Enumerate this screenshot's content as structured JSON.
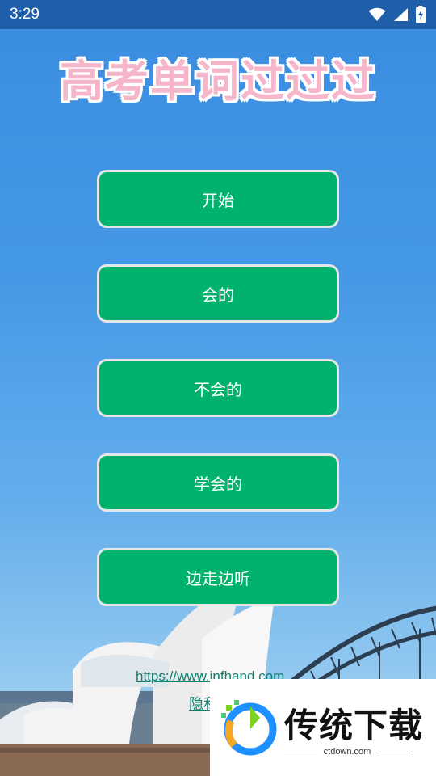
{
  "status_bar": {
    "time": "3:29",
    "icons": [
      "wifi-icon",
      "signal-icon",
      "battery-charging-icon"
    ]
  },
  "app": {
    "title": "高考单词过过过"
  },
  "menu": {
    "buttons": [
      {
        "label": "开始"
      },
      {
        "label": "会的"
      },
      {
        "label": "不会的"
      },
      {
        "label": "学会的"
      },
      {
        "label": "边走边听"
      }
    ]
  },
  "footer": {
    "url_text": "https://www.infhand.com",
    "privacy_text": "隐私"
  },
  "watermark": {
    "name": "传统下载",
    "url": "ctdown.com"
  },
  "colors": {
    "button_bg": "#00b26c",
    "title_pink": "#f6b6c9",
    "status_bar": "#1f5ea8"
  }
}
